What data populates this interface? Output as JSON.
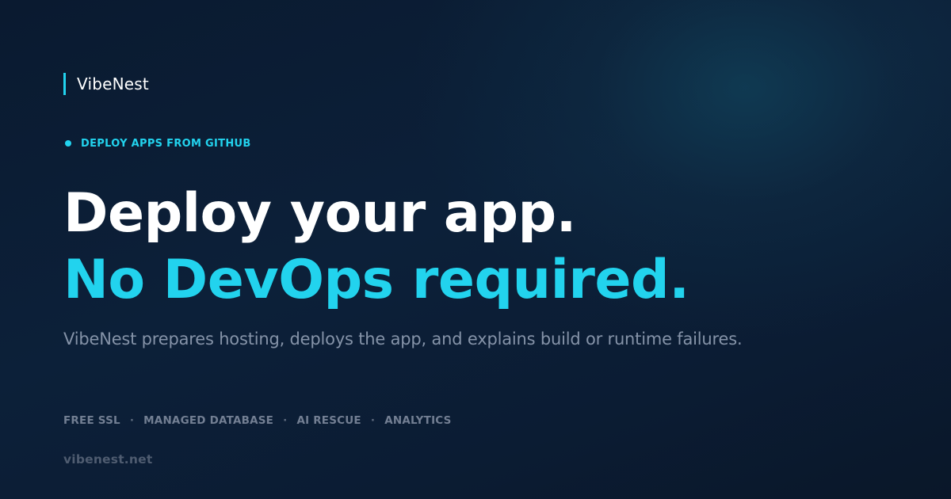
{
  "brand": {
    "name": "VibeNest",
    "accent_color": "#22d3ee"
  },
  "eyebrow": {
    "text": "DEPLOY APPS FROM GITHUB"
  },
  "headline": {
    "line1": "Deploy your app.",
    "line2": "No DevOps required."
  },
  "subtext": "VibeNest prepares hosting, deploys the app, and explains build or runtime failures.",
  "features": {
    "items": [
      "FREE SSL",
      "MANAGED DATABASE",
      "AI RESCUE",
      "ANALYTICS"
    ],
    "separator": "·"
  },
  "footer": {
    "domain": "vibenest.net"
  },
  "colors": {
    "background": "#0b1c33",
    "heading": "#ffffff",
    "muted_text": "#8593a8"
  }
}
